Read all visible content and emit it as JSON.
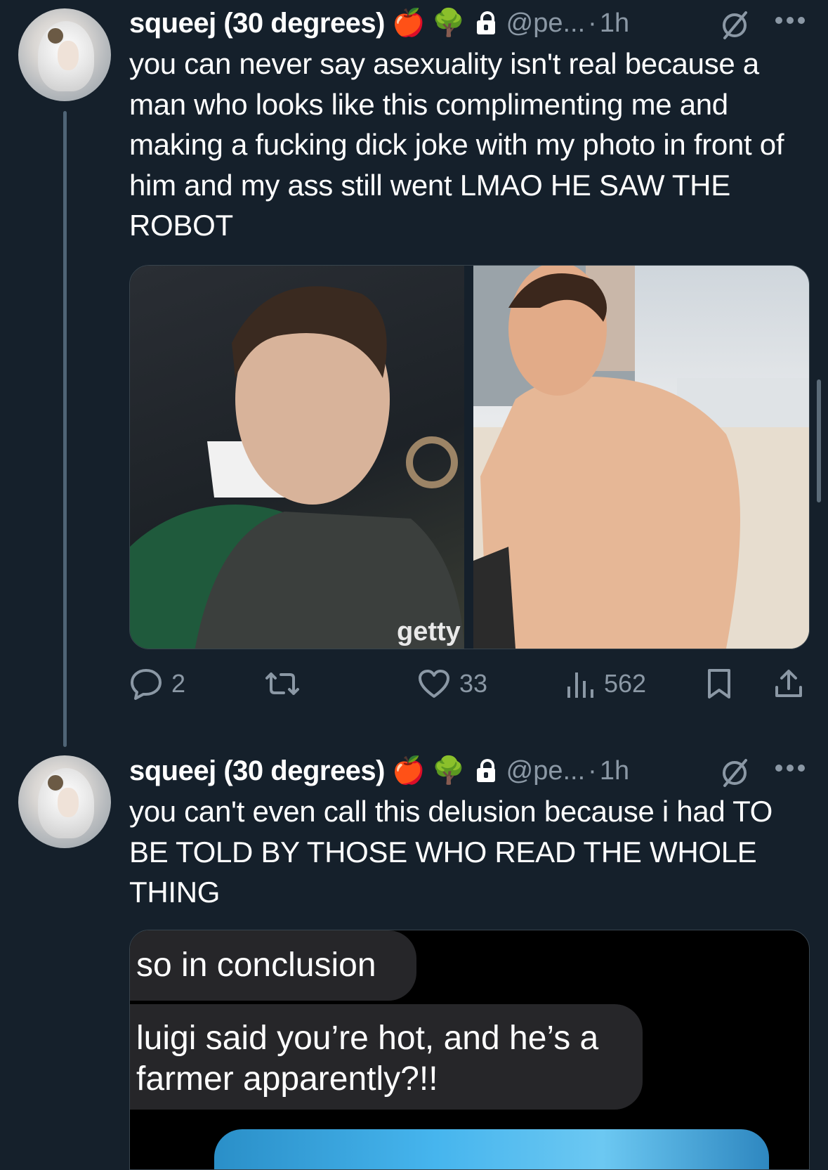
{
  "tweets": [
    {
      "author_name": "squeej (30 degrees)",
      "emoji_badges": [
        "🍎",
        "🌳"
      ],
      "handle": "@pe...",
      "separator": "·",
      "time": "1h",
      "text": "you can never say asexuality isn't real because a man who looks like this complimenting me and making a fucking dick joke with my photo in front of him and my ass still went LMAO HE SAW THE ROBOT",
      "media_watermark": "getty",
      "replies": "2",
      "retweets": "",
      "likes": "33",
      "views": "562"
    },
    {
      "author_name": "squeej (30 degrees)",
      "emoji_badges": [
        "🍎",
        "🌳"
      ],
      "handle": "@pe...",
      "separator": "·",
      "time": "1h",
      "text": "you can't even call this delusion because i had TO BE TOLD BY THOSE WHO READ THE WHOLE THING",
      "chat_bubbles": [
        "so in conclusion",
        "luigi said you’re hot, and he’s a farmer apparently?!!"
      ]
    }
  ],
  "icons": {
    "more": "more-icon",
    "lock": "lock-icon",
    "ghost": "circle-slash-icon",
    "reply": "reply-icon",
    "retweet": "retweet-icon",
    "like": "heart-icon",
    "views": "views-icon",
    "bookmark": "bookmark-icon",
    "share": "share-icon"
  },
  "colors": {
    "background": "#15202b",
    "secondary_text": "#8b98a5",
    "thread_line": "#4f6476"
  }
}
